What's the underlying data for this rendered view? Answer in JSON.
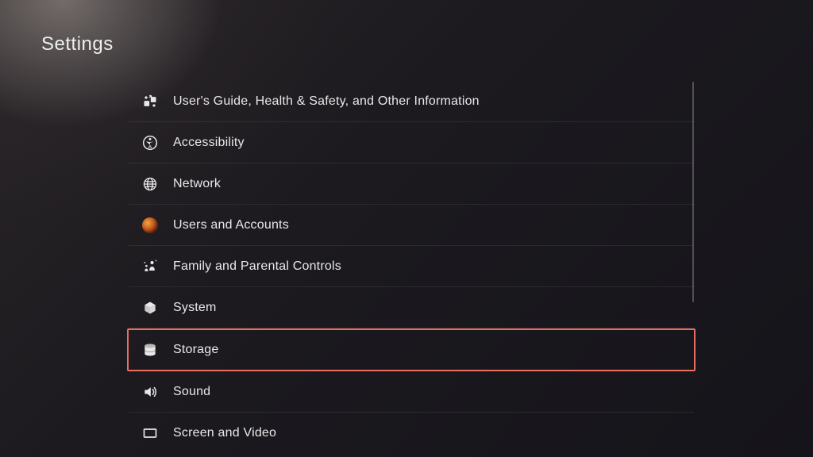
{
  "title": "Settings",
  "menu": {
    "items": [
      {
        "label": "User's Guide, Health & Safety, and Other Information"
      },
      {
        "label": "Accessibility"
      },
      {
        "label": "Network"
      },
      {
        "label": "Users and Accounts"
      },
      {
        "label": "Family and Parental Controls"
      },
      {
        "label": "System"
      },
      {
        "label": "Storage"
      },
      {
        "label": "Sound"
      },
      {
        "label": "Screen and Video"
      }
    ]
  },
  "highlighted_index": 6
}
